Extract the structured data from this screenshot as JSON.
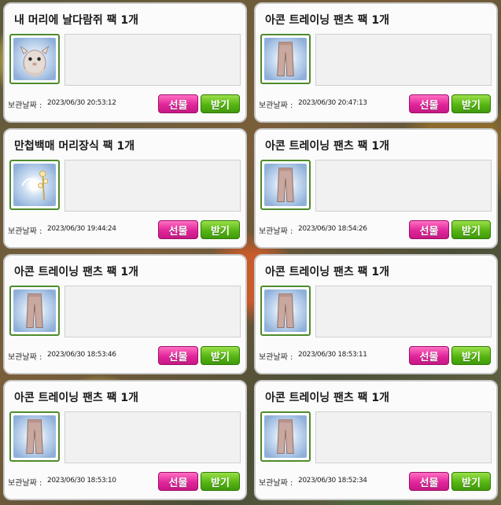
{
  "date_label": "보관날짜 :",
  "buttons": {
    "gift": "선물",
    "receive": "받기"
  },
  "colors": {
    "gift_button": "#e0259a",
    "receive_button": "#57b513",
    "icon_border": "#4e8b2c",
    "card_background": "#fbfbfb"
  },
  "items": [
    {
      "title": "내 머리에 날다람쥐 팩 1개",
      "date": "2023/06/30 20:53:12",
      "icon": "flying-squirrel-icon"
    },
    {
      "title": "아콘 트레이닝 팬츠 팩 1개",
      "date": "2023/06/30 20:47:13",
      "icon": "training-pants-icon"
    },
    {
      "title": "만첩백매 머리장식 팩 1개",
      "date": "2023/06/30 19:44:24",
      "icon": "plum-hair-ornament-icon"
    },
    {
      "title": "아콘 트레이닝 팬츠 팩 1개",
      "date": "2023/06/30 18:54:26",
      "icon": "training-pants-icon"
    },
    {
      "title": "아콘 트레이닝 팬츠 팩 1개",
      "date": "2023/06/30 18:53:46",
      "icon": "training-pants-icon"
    },
    {
      "title": "아콘 트레이닝 팬츠 팩 1개",
      "date": "2023/06/30 18:53:11",
      "icon": "training-pants-icon"
    },
    {
      "title": "아콘 트레이닝 팬츠 팩 1개",
      "date": "2023/06/30 18:53:10",
      "icon": "training-pants-icon"
    },
    {
      "title": "아콘 트레이닝 팬츠 팩 1개",
      "date": "2023/06/30 18:52:34",
      "icon": "training-pants-icon"
    }
  ]
}
